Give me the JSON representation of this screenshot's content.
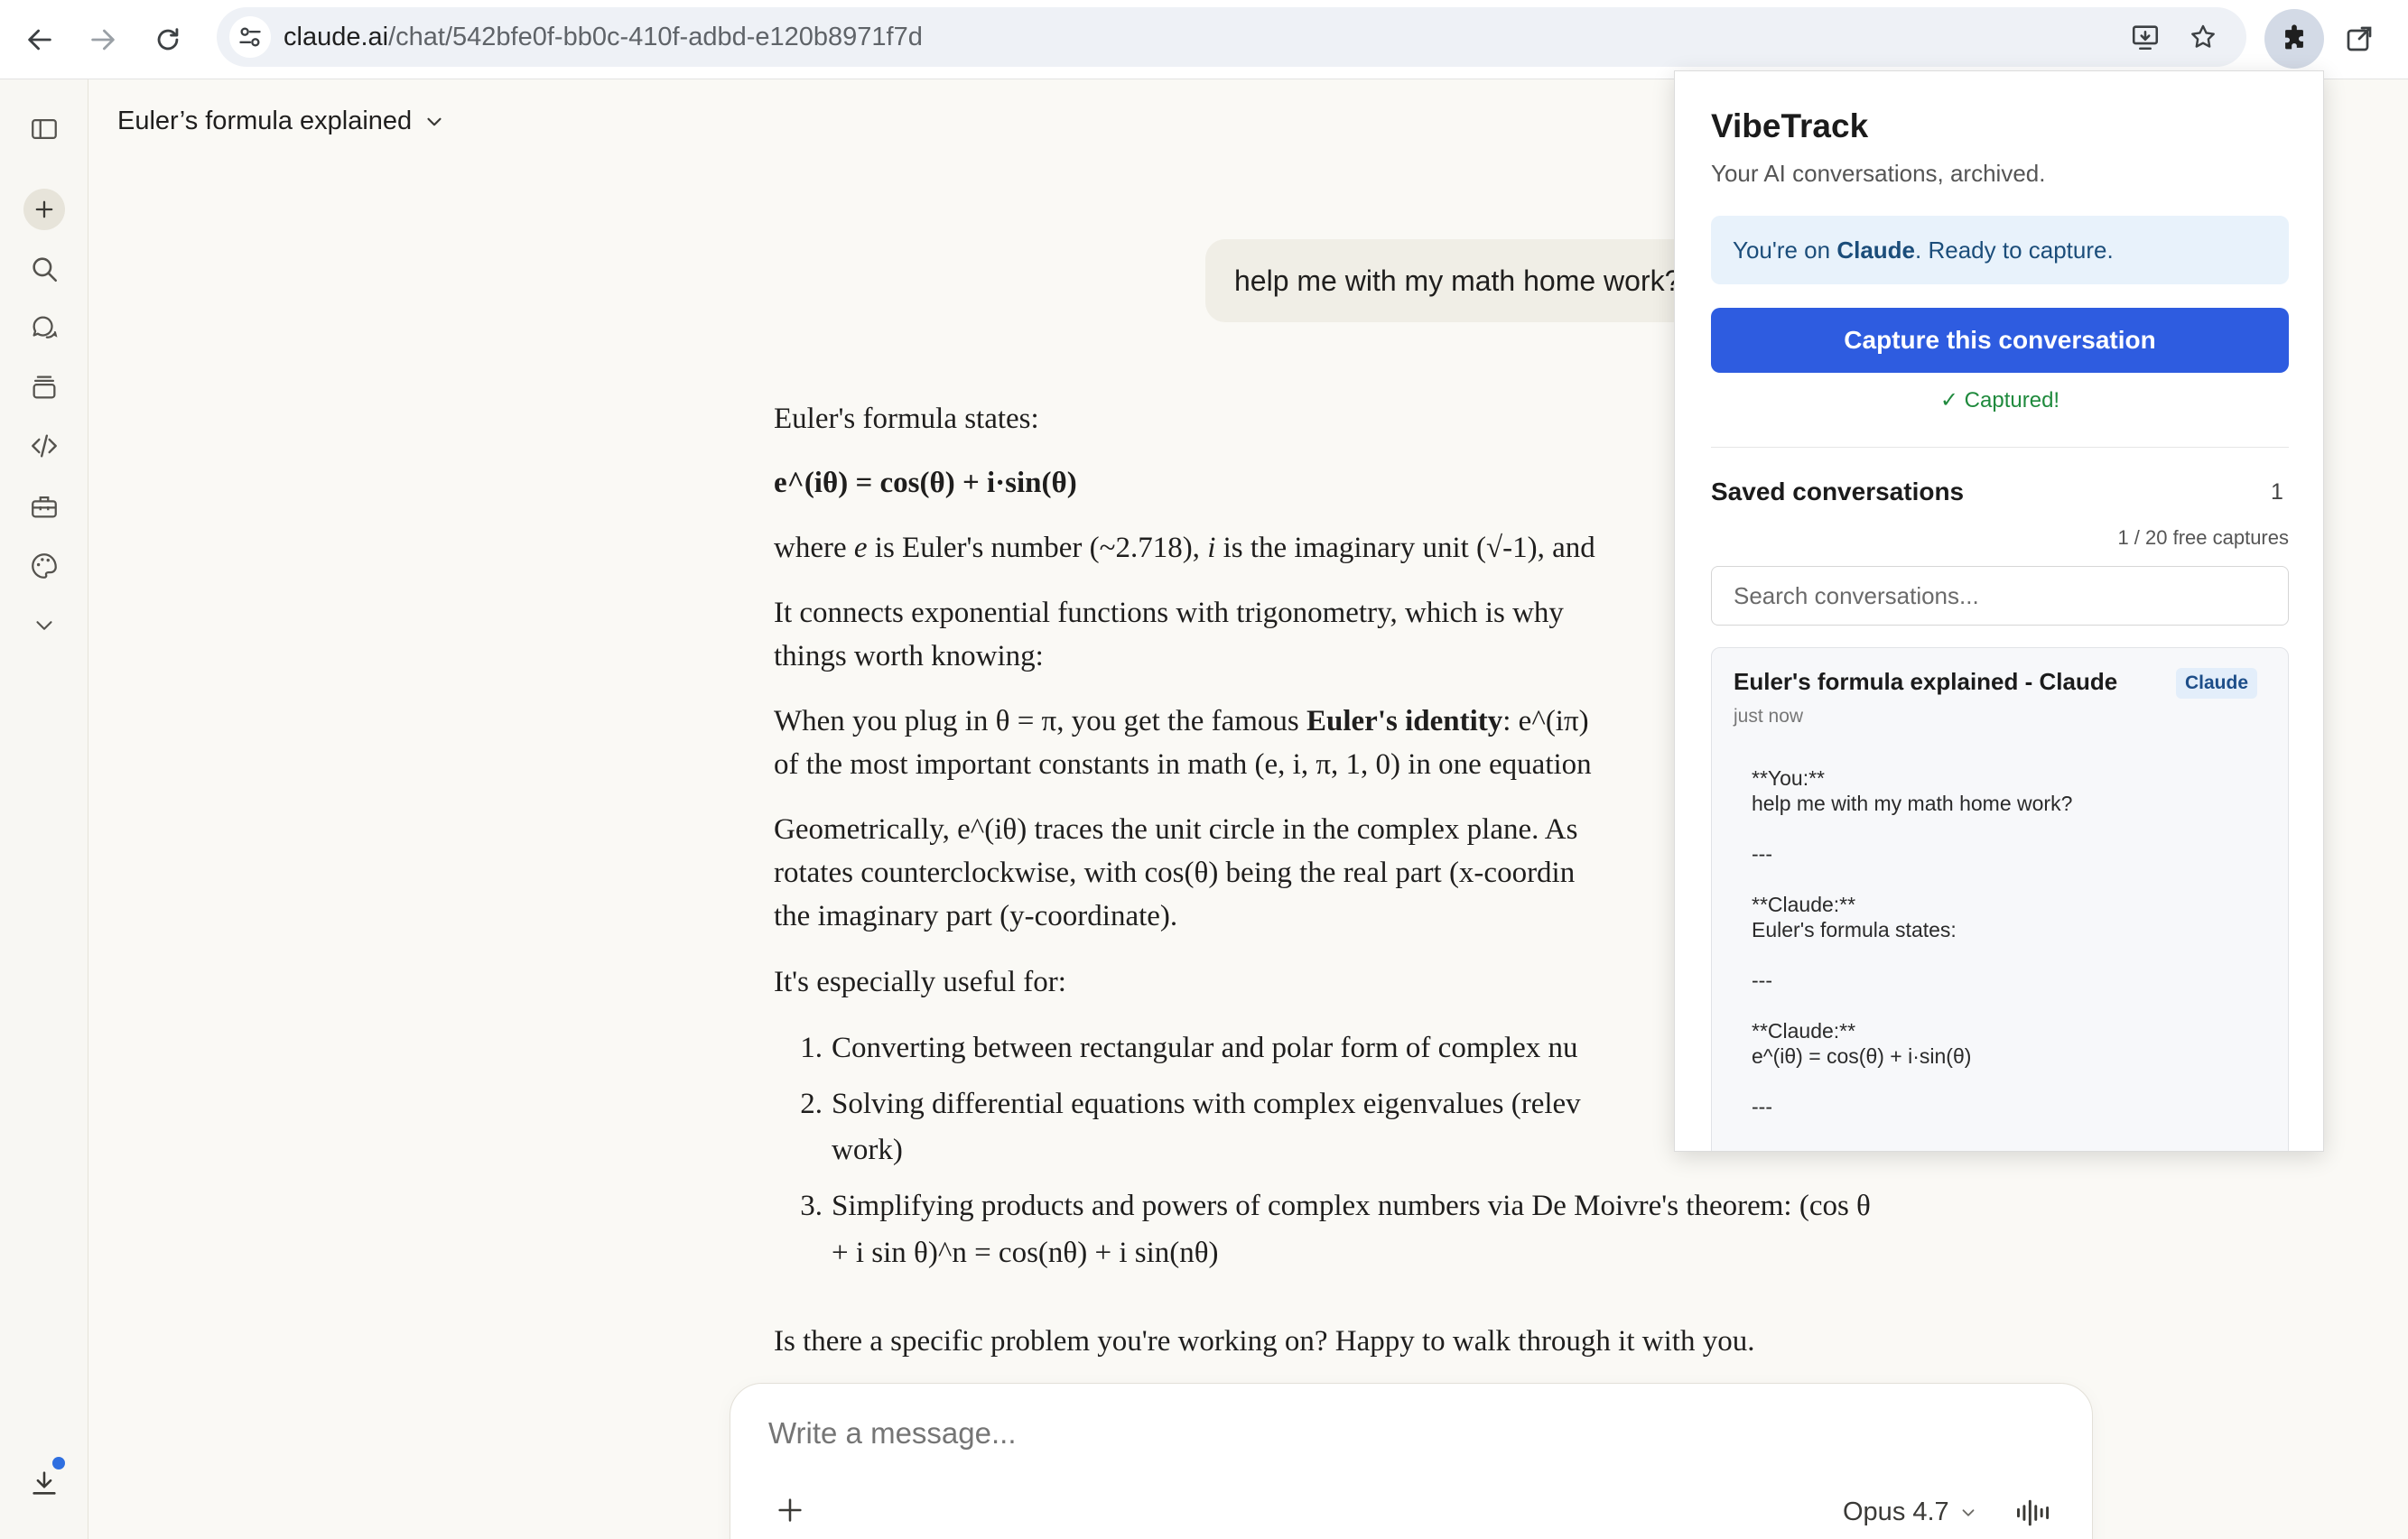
{
  "browser": {
    "url_host": "claude.ai",
    "url_path": "/chat/542bfe0f-bb0c-410f-adbd-e120b8971f7d"
  },
  "chat": {
    "title": "Euler’s formula explained",
    "user_message": "help me with my math home work?",
    "answer": {
      "p1": "Euler's formula states:",
      "p2": "e^(iθ) = cos(θ) + i·sin(θ)",
      "p3_a": "where ",
      "p3_e": "e",
      "p3_b": " is Euler's number (~2.718), ",
      "p3_i": "i",
      "p3_c": " is the imaginary unit (√-1), and",
      "p4_l1": "It connects exponential functions with trigonometry, which is why",
      "p4_l2": "things worth knowing:",
      "p5_l1_a": "When you plug in θ = π, you get the famous ",
      "p5_l1_b": "Euler's identity",
      "p5_l1_c": ": e^(iπ)",
      "p5_l2": "of the most important constants in math (e, i, π, 1, 0) in one equation",
      "p6_l1": "Geometrically, e^(iθ) traces the unit circle in the complex plane. As",
      "p6_l2": "rotates counterclockwise, with cos(θ) being the real part (x-coordin",
      "p6_l3": "the imaginary part (y-coordinate).",
      "p7": "It's especially useful for:",
      "list": [
        {
          "num": "1.",
          "l1": "Converting between rectangular and polar form of complex nu",
          "l2": ""
        },
        {
          "num": "2.",
          "l1": "Solving differential equations with complex eigenvalues (relev",
          "l2": "work)"
        },
        {
          "num": "3.",
          "l1": "Simplifying products and powers of complex numbers via De Moivre's theorem: (cos θ",
          "l2": "+ i sin θ)^n = cos(nθ) + i sin(nθ)"
        }
      ],
      "closing": "Is there a specific problem you're working on? Happy to walk through it with you."
    }
  },
  "composer": {
    "placeholder": "Write a message...",
    "model": "Opus 4.7"
  },
  "extension": {
    "title": "VibeTrack",
    "subtitle": "Your AI conversations, archived.",
    "status_prefix": "You're on ",
    "status_site": "Claude",
    "status_suffix": ". Ready to capture.",
    "capture_label": "Capture this conversation",
    "captured_msg": "✓ Captured!",
    "saved_heading": "Saved conversations",
    "saved_count": "1",
    "free_captures": "1 / 20 free captures",
    "search_placeholder": "Search conversations...",
    "card": {
      "title": "Euler's formula explained - Claude",
      "badge": "Claude",
      "time": "just now",
      "body": "**You:**\nhelp me with my math home work?\n\n---\n\n**Claude:**\nEuler's formula states:\n\n---\n\n**Claude:**\ne^(iθ) = cos(θ) + i·sin(θ)\n\n---"
    }
  }
}
